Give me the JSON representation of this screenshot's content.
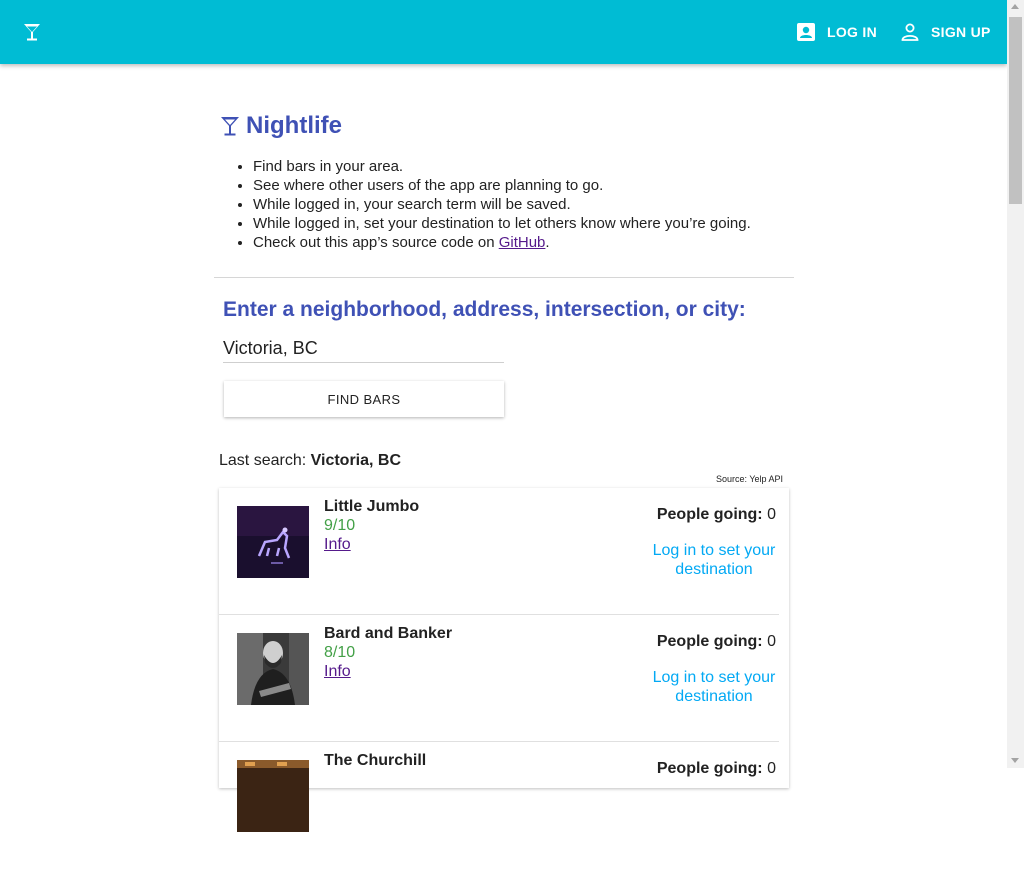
{
  "header": {
    "login_label": "LOG IN",
    "signup_label": "SIGN UP",
    "brand_icon": "cocktail-icon",
    "login_icon": "account-box-icon",
    "signup_icon": "person-outline-icon",
    "background_color": "#00bcd4"
  },
  "main": {
    "title": "Nightlife",
    "title_color": "#3f51b5",
    "features": [
      "Find bars in your area.",
      "See where other users of the app are planning to go.",
      "While logged in, your search term will be saved.",
      "While logged in, set your destination to let others know where you’re going.",
      "Check out this app’s source code on "
    ],
    "github_link": "GitHub",
    "features_tail": ".",
    "search_prompt": "Enter a neighborhood, address, intersection, or city:",
    "search_value": "Victoria, BC",
    "find_button": "FIND BARS",
    "last_search_label": "Last search:",
    "last_search_value": "Victoria, BC",
    "source_label": "Source: Yelp API"
  },
  "results": [
    {
      "name": "Little Jumbo",
      "rating": "9/10",
      "info_label": "Info",
      "people_going_label": "People going:",
      "people_going_count": "0",
      "login_prompt": "Log in to set your destination"
    },
    {
      "name": "Bard and Banker",
      "rating": "8/10",
      "info_label": "Info",
      "people_going_label": "People going:",
      "people_going_count": "0",
      "login_prompt": "Log in to set your destination"
    },
    {
      "name": "The Churchill",
      "rating": "",
      "info_label": "",
      "people_going_label": "People going:",
      "people_going_count": "0",
      "login_prompt": ""
    }
  ]
}
